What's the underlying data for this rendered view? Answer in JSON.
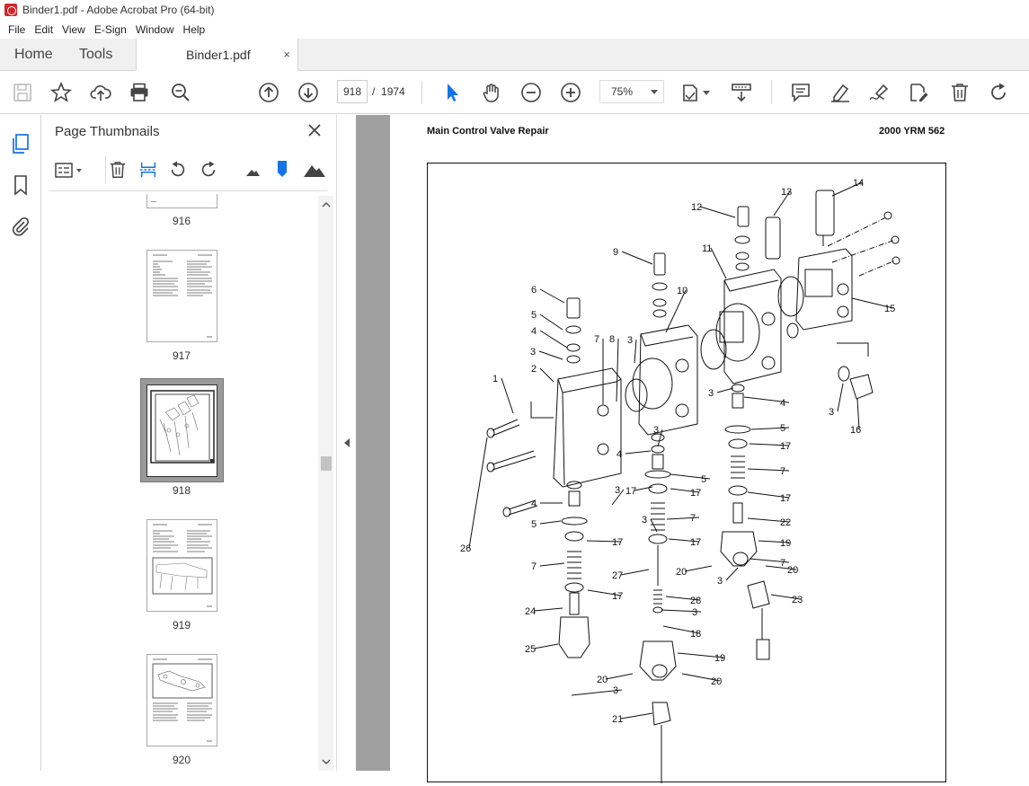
{
  "window": {
    "title": "Binder1.pdf - Adobe Acrobat Pro (64-bit)"
  },
  "menu": [
    "File",
    "Edit",
    "View",
    "E-Sign",
    "Window",
    "Help"
  ],
  "tabs": {
    "home": "Home",
    "tools": "Tools",
    "document": "Binder1.pdf",
    "close": "×"
  },
  "toolbar": {
    "current_page": "918",
    "page_separator": "/",
    "total_pages": "1974",
    "zoom": "75%"
  },
  "panel": {
    "title": "Page Thumbnails",
    "thumbnails": [
      {
        "label": "916"
      },
      {
        "label": "917"
      },
      {
        "label": "918",
        "selected": true
      },
      {
        "label": "919"
      },
      {
        "label": "920"
      }
    ]
  },
  "document": {
    "header_left": "Main Control Valve Repair",
    "header_right": "2000 YRM 562",
    "callouts": [
      "1",
      "2",
      "3",
      "3",
      "3",
      "3",
      "3",
      "3",
      "3",
      "3",
      "3",
      "3",
      "4",
      "4",
      "4",
      "4",
      "5",
      "5",
      "5",
      "5",
      "6",
      "7",
      "7",
      "7",
      "7",
      "7",
      "8",
      "9",
      "10",
      "11",
      "12",
      "13",
      "14",
      "15",
      "16",
      "17",
      "17",
      "17",
      "17",
      "17",
      "17",
      "17",
      "18",
      "19",
      "19",
      "20",
      "20",
      "20",
      "20",
      "21",
      "22",
      "23",
      "24",
      "25",
      "26",
      "27",
      "28"
    ]
  },
  "colors": {
    "accent": "#1473e6",
    "pdf_red": "#d4262a",
    "canvas": "#a0a0a0"
  }
}
